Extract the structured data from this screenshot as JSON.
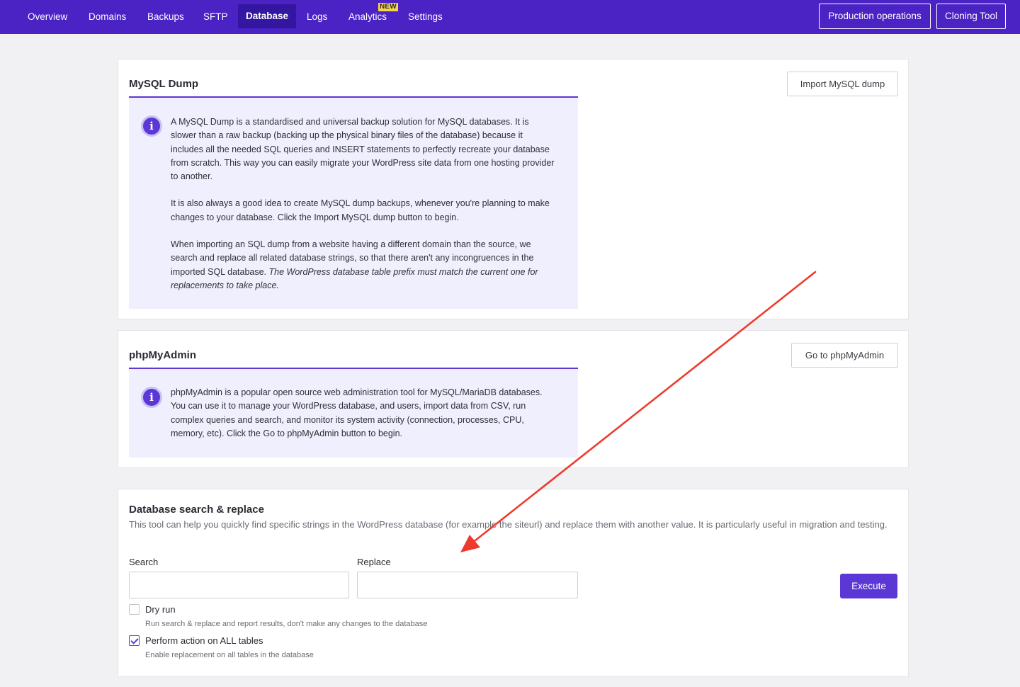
{
  "nav": {
    "items": [
      {
        "label": "Overview"
      },
      {
        "label": "Domains"
      },
      {
        "label": "Backups"
      },
      {
        "label": "SFTP"
      },
      {
        "label": "Database"
      },
      {
        "label": "Logs"
      },
      {
        "label": "Analytics"
      },
      {
        "label": "Settings"
      }
    ],
    "active": "Database",
    "analytics_badge": "NEW",
    "production_operations": "Production operations",
    "cloning_tool": "Cloning Tool"
  },
  "mysql_dump": {
    "title": "MySQL Dump",
    "import_button": "Import MySQL dump",
    "paragraph_1": "A MySQL Dump is a standardised and universal backup solution for MySQL databases. It is slower than a raw backup (backing up the physical binary files of the database) because it includes all the needed SQL queries and INSERT statements to perfectly recreate your database from scratch. This way you can easily migrate your WordPress site data from one hosting provider to another.",
    "paragraph_2": "It is also always a good idea to create MySQL dump backups, whenever you're planning to make changes to your database. Click the Import MySQL dump button to begin.",
    "paragraph_3": "When importing an SQL dump from a website having a different domain than the source, we search and replace all related database strings, so that there aren't any incongruences in the imported SQL database.",
    "paragraph_3_note": "The WordPress database table prefix must match the current one for replacements to take place."
  },
  "phpmyadmin": {
    "title": "phpMyAdmin",
    "go_button": "Go to phpMyAdmin",
    "paragraph": "phpMyAdmin is a popular open source web administration tool for MySQL/MariaDB databases. You can use it to manage your WordPress database, and users, import data from CSV, run complex queries and search, and monitor its system activity (connection, processes, CPU, memory, etc). Click the Go to phpMyAdmin button to begin."
  },
  "search_replace": {
    "title": "Database search & replace",
    "description": "This tool can help you quickly find specific strings in the WordPress database (for example the siteurl) and replace them with another value. It is particularly useful in migration and testing.",
    "search_label": "Search",
    "search_value": "",
    "replace_label": "Replace",
    "replace_value": "",
    "execute_button": "Execute",
    "dry_run": {
      "label": "Dry run",
      "hint": "Run search & replace and report results, don't make any changes to the database",
      "checked": false
    },
    "all_tables": {
      "label": "Perform action on ALL tables",
      "hint": "Enable replacement on all tables in the database",
      "checked": true
    }
  },
  "colors": {
    "brand": "#4b22c4",
    "accent": "#5b38d6",
    "annotation_arrow": "#ee3a2c"
  },
  "icons": [
    "info-icon",
    "checkmark-icon",
    "annotation-arrow"
  ]
}
